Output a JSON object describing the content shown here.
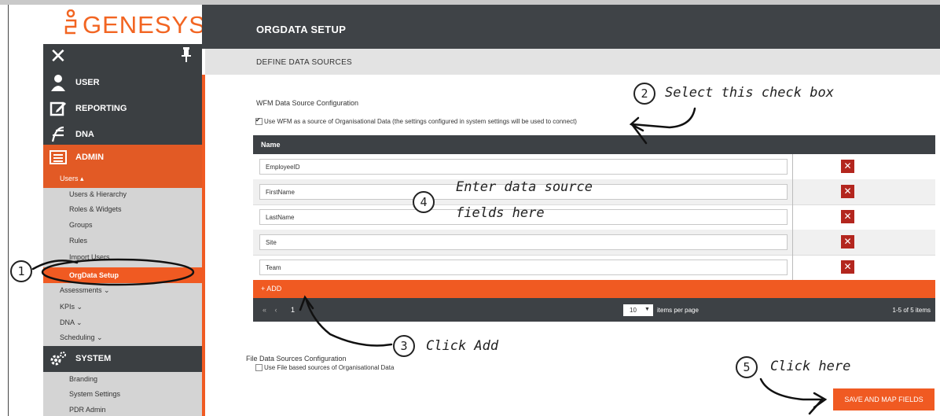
{
  "brand": {
    "logo_text": "GENESYS"
  },
  "sidebar": {
    "close": "✕",
    "nav": [
      {
        "label": "USER",
        "icon": "user-icon"
      },
      {
        "label": "REPORTING",
        "icon": "edit-icon"
      },
      {
        "label": "DNA",
        "icon": "dna-icon"
      },
      {
        "label": "ADMIN",
        "icon": "admin-icon"
      }
    ],
    "users_header": "Users ▴",
    "users_items": [
      "Users & Hierarchy",
      "Roles & Widgets",
      "Groups",
      "Rules",
      "Import Users"
    ],
    "active_item": "OrgData Setup",
    "sections": [
      "Assessments ⌄",
      "KPIs ⌄",
      "DNA ⌄",
      "Scheduling ⌄"
    ],
    "system_label": "SYSTEM",
    "system_items": [
      "Branding",
      "System Settings",
      "PDR Admin"
    ]
  },
  "header": {
    "title": "ORGDATA SETUP"
  },
  "subheader": {
    "title": "DEFINE DATA SOURCES"
  },
  "wfm": {
    "title": "WFM Data Source Configuration",
    "checkbox_label": "Use WFM as a source of Organisational Data (the settings configured in system settings will be used to connect)",
    "checked": true
  },
  "grid": {
    "column": "Name",
    "rows": [
      "EmployeeID",
      "FirstName",
      "LastName",
      "Site",
      "Team"
    ],
    "delete_glyph": "✕",
    "add_label": "+ ADD",
    "pager_nav": "« ‹",
    "page": "1",
    "per_page": "10",
    "per_page_caret": "▼",
    "per_page_label": "items per page",
    "count": "1-5 of 5 items"
  },
  "file": {
    "title": "File Data Sources Configuration",
    "checkbox_label": "Use File based sources of Organisational Data",
    "checked": false
  },
  "save_button": "SAVE AND MAP FIELDS",
  "annotations": {
    "n1": "1",
    "n2": "2",
    "n3": "3",
    "n4": "4",
    "n5": "5",
    "t2": "Select this check box",
    "t3": "Click Add",
    "t4a": "Enter data source",
    "t4b": "fields here",
    "t5": "Click here"
  },
  "colors": {
    "accent": "#f05a22",
    "dark": "#3d4145",
    "delete": "#b3261e"
  }
}
